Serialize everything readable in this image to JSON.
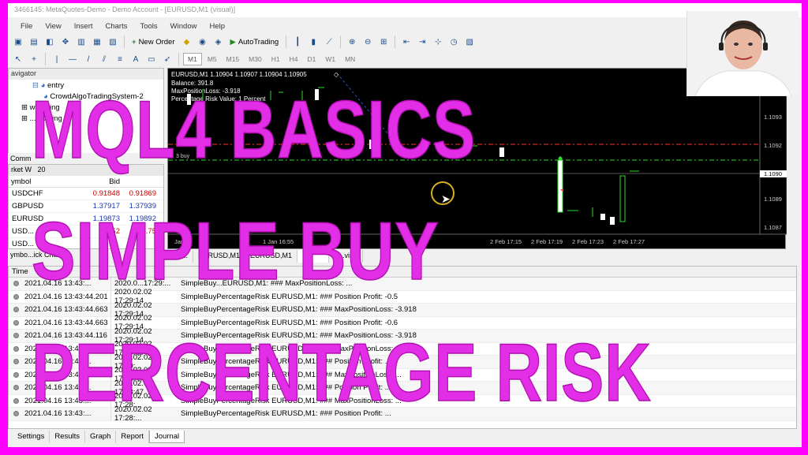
{
  "window": {
    "title": "3466145: MetaQuotes-Demo - Demo Account - [EURUSD,M1 (visual)]"
  },
  "menu": [
    "File",
    "View",
    "Insert",
    "Charts",
    "Tools",
    "Window",
    "Help"
  ],
  "toolbar": {
    "new_order": "New Order",
    "autotrading": "AutoTrading"
  },
  "timeframes": [
    "M1",
    "M5",
    "M15",
    "M30",
    "H1",
    "H4",
    "D1",
    "W1",
    "MN"
  ],
  "navigator": {
    "header": "avigator",
    "items": [
      {
        "label": "entry"
      },
      {
        "label": "CrowdAlgoTradingSystem-2"
      },
      {
        "label": "wo...ding"
      },
      {
        "label": "...lgo...ing"
      }
    ]
  },
  "comm_tab": "Comm",
  "market_watch": {
    "title": "rket W",
    "time": "20",
    "col_symbol": "ymbol",
    "col_bid": "Bid",
    "col_ask": "",
    "rows": [
      {
        "symbol": "USDCHF",
        "bid": "0.91848",
        "ask": "0.91869"
      },
      {
        "symbol": "GBPUSD",
        "bid": "1.37917",
        "ask": "1.37939"
      },
      {
        "symbol": "EURUSD",
        "bid": "1.19873",
        "ask": "1.19892"
      },
      {
        "symbol": "USD...",
        "bid": "...52",
        "ask": "...75"
      },
      {
        "symbol": "USD...",
        "bid": "",
        "ask": ""
      }
    ]
  },
  "mw_tabs": "ymbo...ick Char",
  "chart": {
    "info_line": "EURUSD,M1  1.10904 1.10907 1.10904 1.10905",
    "balance": "Balance: 391.8",
    "max_loss": "MaxPositionLoss: -3.918",
    "risk": "Percentage Risk Value: 1 Percent",
    "tp_label": "3 tp",
    "buy_label": "3 buy",
    "prices": [
      "1.1093",
      "1.1092",
      "1.1090",
      "1.1089",
      "1.1087"
    ],
    "current_price": "1.1090",
    "time_labels": [
      "Jan",
      "1 Jan 16:55",
      "2 Feb 17:15",
      "2 Feb 17:19",
      "2 Feb 17:23",
      "2 Feb 17:27"
    ]
  },
  "chart_tabs": [
    "EU...",
    "EURUSD,M1",
    "EURUSD,M1",
    "",
    "S...visu"
  ],
  "journal": {
    "col_time": "Time",
    "rows": [
      {
        "time": "2021.04.16 13:43:...",
        "sim_time": "2020.0...17:29:...",
        "message": "SimpleBuy...EURUSD,M1: ### MaxPositionLoss: ..."
      },
      {
        "time": "2021.04.16 13:43:44.201",
        "sim_time": "2020.02.02 17:29:14",
        "message": "SimpleBuyPercentageRisk EURUSD,M1: ### Position Profit: -0.5"
      },
      {
        "time": "2021.04.16 13:43:44.663",
        "sim_time": "2020.02.02 17:29:14",
        "message": "SimpleBuyPercentageRisk EURUSD,M1: ### MaxPositionLoss: -3.918"
      },
      {
        "time": "2021.04.16 13:43:44.663",
        "sim_time": "2020.02.02 17:29:14",
        "message": "SimpleBuyPercentageRisk EURUSD,M1: ### Position Profit: -0.6"
      },
      {
        "time": "2021.04.16 13:43:44.116",
        "sim_time": "2020.02.02 17:29:14",
        "message": "SimpleBuyPercentageRisk EURUSD,M1: ### MaxPositionLoss: -3.918"
      },
      {
        "time": "2021.04.16 13:43:...",
        "sim_time": "2020.02.02 17:29:00",
        "message": "SimpleBuyPercentageRisk EURUSD,M1: ### MaxPositionLoss: ..."
      },
      {
        "time": "2021.04.16 13:43:...",
        "sim_time": "2020.02.02 17:29:...",
        "message": "SimpleBuyPercentageRisk EURUSD,M1: ### Position Profit: ..."
      },
      {
        "time": "2021.04.16 13:43:...",
        "sim_time": "2020.02.02 17:28:47",
        "message": "SimpleBuyPercentageRisk EURUSD,M1: ### MaxPositionLoss: ..."
      },
      {
        "time": "2021.04.16 13:43:...",
        "sim_time": "2020.02.02 17:28:47",
        "message": "SimpleBuyPercentageRisk EURUSD,M1: ### Position Profit: ..."
      },
      {
        "time": "2021.04.16 13:43:...",
        "sim_time": "2020.02.02 17:28:...",
        "message": "SimpleBuyPercentageRisk EURUSD,M1: ### MaxPositionLoss: ..."
      },
      {
        "time": "2021.04.16 13:43:...",
        "sim_time": "2020.02.02 17:28:...",
        "message": "SimpleBuyPercentageRisk EURUSD,M1: ### Position Profit: ..."
      }
    ]
  },
  "bottom_tabs": [
    "Settings",
    "Results",
    "Graph",
    "Report",
    "Journal"
  ],
  "overlay": {
    "line1": "MQL4 BASICS",
    "line2": "SIMPLE BUY",
    "line3": "PERCENTAGE RISK"
  },
  "colors": {
    "overlay_text": "#e22ee6",
    "background": "#ff00ff"
  }
}
